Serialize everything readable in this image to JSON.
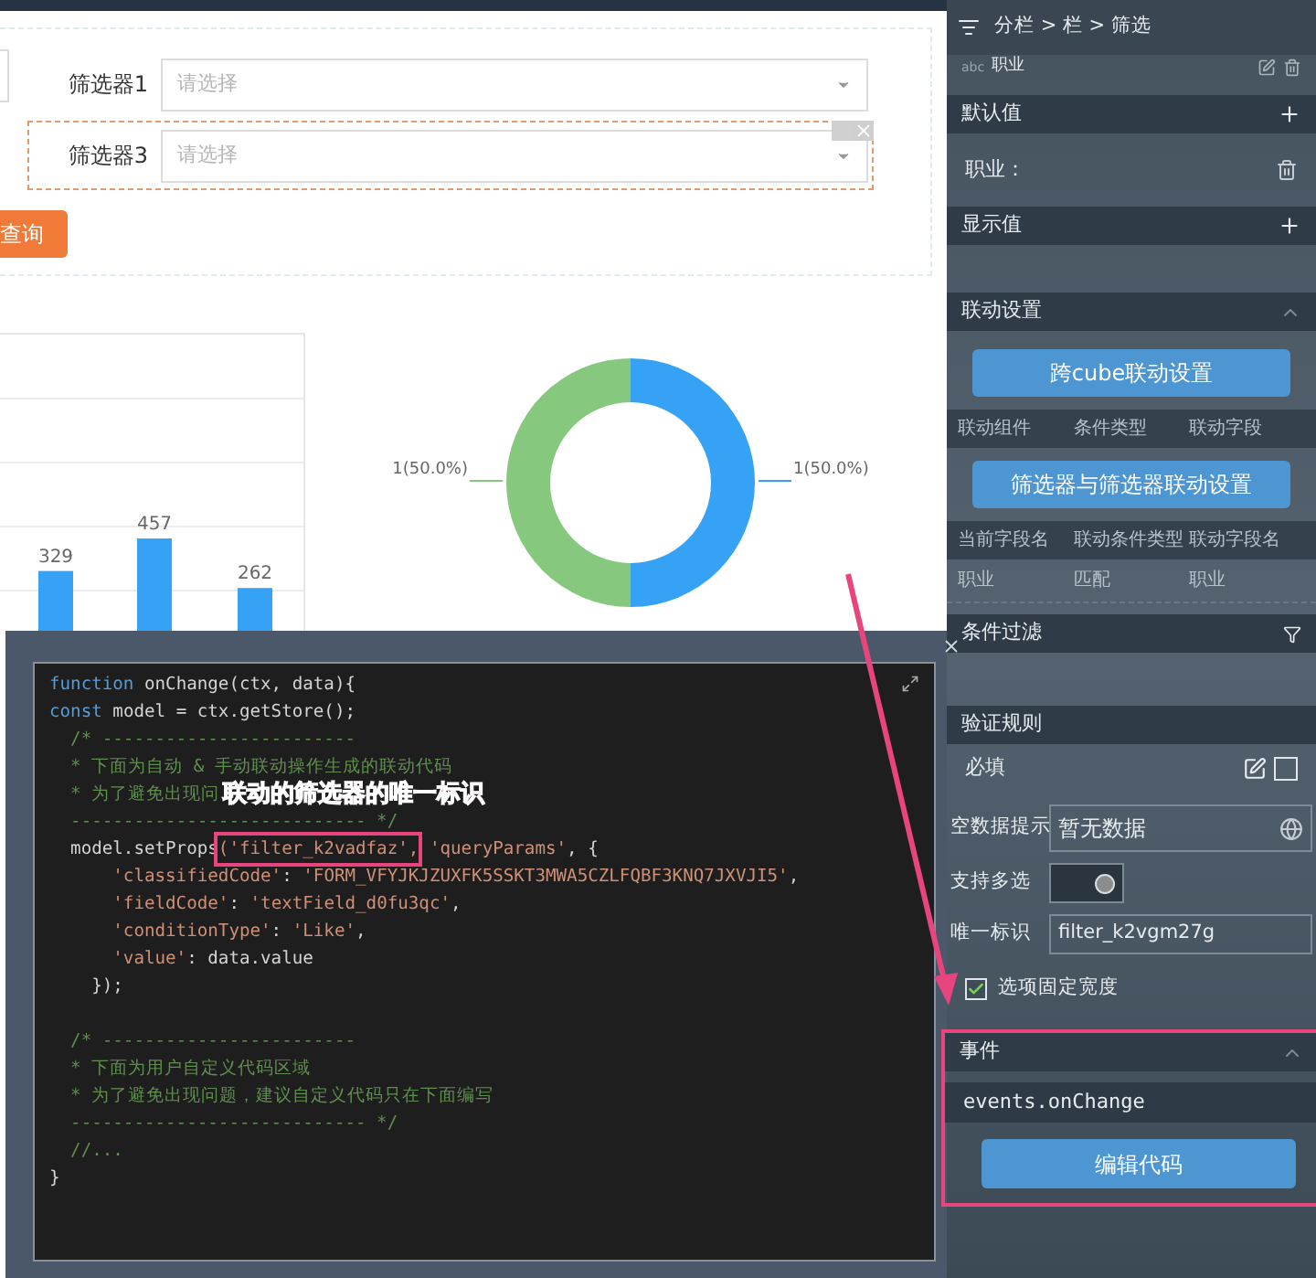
{
  "form": {
    "filters": [
      {
        "label": "筛选器1",
        "placeholder": "请选择",
        "selected": false
      },
      {
        "label": "筛选器3",
        "placeholder": "请选择",
        "selected": true
      }
    ],
    "query_button": "查询"
  },
  "bar_chart": {
    "bar_labels": [
      "329",
      "457",
      "262"
    ]
  },
  "donut_chart": {
    "chart_data": {
      "type": "donut",
      "values": [
        1,
        1
      ],
      "value_labels": [
        "1(50.0%)",
        "1(50.0%)"
      ]
    }
  },
  "code_editor": {
    "lines": [
      [
        {
          "kind": "kw",
          "text": "function"
        },
        {
          "kind": "plain",
          "text": " onChange(ctx, data){"
        }
      ],
      [
        {
          "kind": "kw",
          "text": "const"
        },
        {
          "kind": "plain",
          "text": " model = ctx.getStore();"
        }
      ],
      [
        {
          "kind": "comment",
          "text": "  /* ------------------------"
        }
      ],
      [
        {
          "kind": "comment",
          "text": "  * 下面为自动 & 手动联动操作生成的联动代码"
        }
      ],
      [
        {
          "kind": "comment",
          "text": "  * 为了避免出现问"
        },
        {
          "kind": "note",
          "text": "联动的筛选器的唯一标识"
        }
      ],
      [
        {
          "kind": "comment",
          "text": "  ---------------------------- */"
        }
      ],
      [
        {
          "kind": "plain",
          "text": "  model.setProps"
        },
        {
          "kind": "boxed",
          "text": "('filter_k2vadfaz',"
        },
        {
          "kind": "str",
          "text": " 'queryParams'"
        },
        {
          "kind": "plain",
          "text": ", {"
        }
      ],
      [
        {
          "kind": "str",
          "text": "      'classifiedCode'"
        },
        {
          "kind": "plain",
          "text": ": "
        },
        {
          "kind": "str",
          "text": "'FORM_VFYJKJZUXFK5SSKT3MWA5CZLFQBF3KNQ7JXVJI5'"
        },
        {
          "kind": "plain",
          "text": ","
        }
      ],
      [
        {
          "kind": "str",
          "text": "      'fieldCode'"
        },
        {
          "kind": "plain",
          "text": ": "
        },
        {
          "kind": "str",
          "text": "'textField_d0fu3qc'"
        },
        {
          "kind": "plain",
          "text": ","
        }
      ],
      [
        {
          "kind": "str",
          "text": "      'conditionType'"
        },
        {
          "kind": "plain",
          "text": ": "
        },
        {
          "kind": "str",
          "text": "'Like'"
        },
        {
          "kind": "plain",
          "text": ","
        }
      ],
      [
        {
          "kind": "str",
          "text": "      'value'"
        },
        {
          "kind": "plain",
          "text": ": data.value"
        }
      ],
      [
        {
          "kind": "plain",
          "text": "    });"
        }
      ],
      [
        {
          "kind": "blank"
        }
      ],
      [
        {
          "kind": "comment",
          "text": "  /* ------------------------"
        }
      ],
      [
        {
          "kind": "comment",
          "text": "  * 下面为用户自定义代码区域"
        }
      ],
      [
        {
          "kind": "comment",
          "text": "  * 为了避免出现问题，建议自定义代码只在下面编写"
        }
      ],
      [
        {
          "kind": "comment",
          "text": "  ---------------------------- */"
        }
      ],
      [
        {
          "kind": "comment",
          "text": "  //..."
        }
      ],
      [
        {
          "kind": "plain",
          "text": "}"
        }
      ]
    ]
  },
  "panel": {
    "breadcrumb": "分栏 > 栏 > 筛选",
    "field": {
      "type_tag": "abc",
      "name": "职业"
    },
    "default_value": {
      "title": "默认值",
      "item": "职业："
    },
    "display_value": {
      "title": "显示值"
    },
    "linkage": {
      "title": "联动设置",
      "expanded": true,
      "cube_button": "跨cube联动设置",
      "cube_columns": [
        "联动组件",
        "条件类型",
        "联动字段"
      ],
      "filter_button": "筛选器与筛选器联动设置",
      "filter_columns": [
        "当前字段名",
        "联动条件类型",
        "联动字段名"
      ],
      "filter_rows": [
        [
          "职业",
          "匹配",
          "职业"
        ]
      ]
    },
    "condition_filter": {
      "title": "条件过滤"
    },
    "validation": {
      "title": "验证规则",
      "required": {
        "label": "必填",
        "checked": false
      },
      "empty_hint": {
        "label": "空数据提示",
        "value": "暂无数据"
      },
      "multi_select": {
        "label": "支持多选",
        "on": true
      },
      "unique_id": {
        "label": "唯一标识",
        "value": "filter_k2vgm27g"
      },
      "fixed_width": {
        "label": "选项固定宽度",
        "checked": true
      }
    },
    "events": {
      "title": "事件",
      "expanded": true,
      "value": "events.onChange",
      "edit_button": "编辑代码"
    }
  }
}
